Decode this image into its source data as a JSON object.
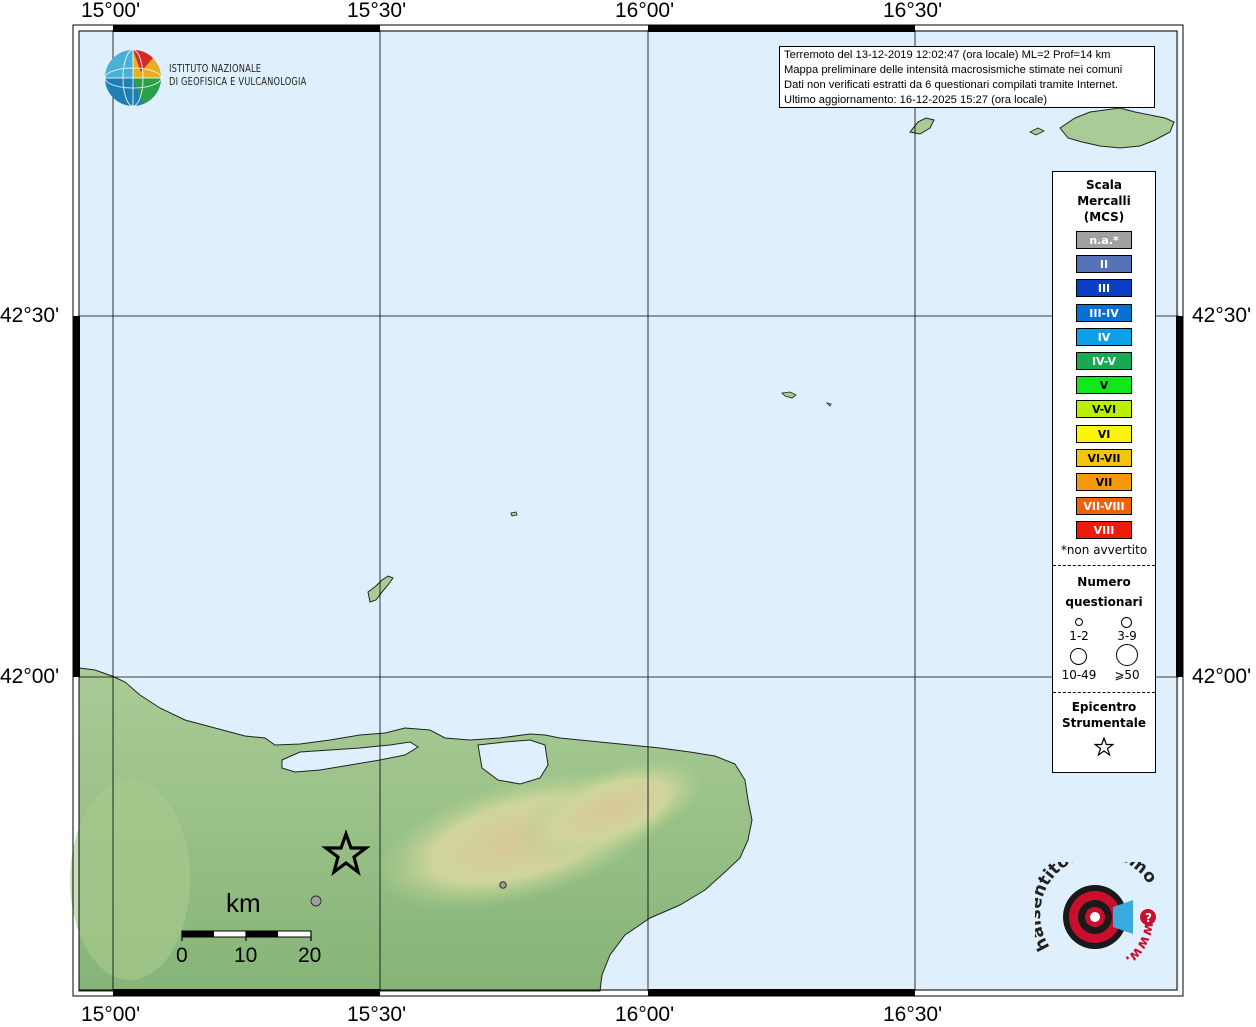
{
  "map": {
    "lon_labels": [
      "15°00'",
      "15°30'",
      "16°00'",
      "16°30'"
    ],
    "lat_labels": [
      "42°30'",
      "42°00'"
    ],
    "colors": {
      "sea": "#dff0fc",
      "land": "#9cc38a",
      "frame": "#000000"
    }
  },
  "info": {
    "line1": "Terremoto del 13-12-2019 12:02:47 (ora locale) ML=2 Prof=14 km",
    "line2": "Mappa preliminare delle intensità macrosismiche stimate nei comuni",
    "line3": "Dati non verificati estratti da 6 questionari compilati tramite Internet.",
    "line4": "Ultimo aggiornamento: 16-12-2025 15:27 (ora locale)"
  },
  "logo": {
    "line1": "ISTITUTO NAZIONALE",
    "line2": "DI GEOFISICA E VULCANOLOGIA"
  },
  "legend": {
    "title_line1": "Scala",
    "title_line2": "Mercalli",
    "title_line3": "(MCS)",
    "scale": [
      {
        "label": "n.a.*",
        "color": "#a0a0a0"
      },
      {
        "label": "II",
        "color": "#5672b8"
      },
      {
        "label": "III",
        "color": "#0a3fc4"
      },
      {
        "label": "III-IV",
        "color": "#0a6fd4"
      },
      {
        "label": "IV",
        "color": "#0f9fe6"
      },
      {
        "label": "IV-V",
        "color": "#1aa850"
      },
      {
        "label": "V",
        "color": "#14e61e"
      },
      {
        "label": "V-VI",
        "color": "#b8f000"
      },
      {
        "label": "VI",
        "color": "#fbf50a"
      },
      {
        "label": "VI-VII",
        "color": "#f7c20a"
      },
      {
        "label": "VII",
        "color": "#f79a0a"
      },
      {
        "label": "VII-VIII",
        "color": "#f0620a"
      },
      {
        "label": "VIII",
        "color": "#ee1a0a"
      }
    ],
    "note": "*non avvertito",
    "questionari_title1": "Numero",
    "questionari_title2": "questionari",
    "q1": "1-2",
    "q2": "3-9",
    "q3": "10-49",
    "q4": "⩾50",
    "epicentro_title1": "Epicentro",
    "epicentro_title2": "Strumentale"
  },
  "scalebar": {
    "unit": "km",
    "labels": [
      "0",
      "10",
      "20"
    ]
  },
  "badge": {
    "text": "haisentitoilterremoto.it",
    "www": "www."
  }
}
